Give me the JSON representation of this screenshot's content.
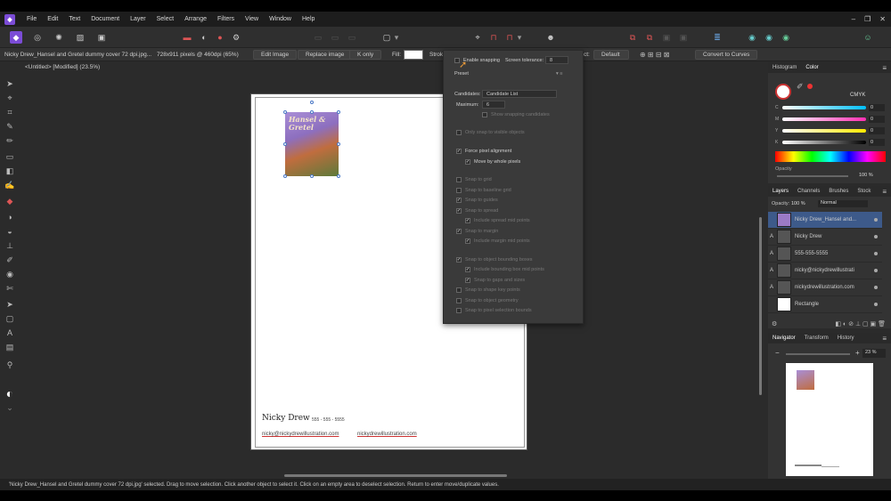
{
  "menu": {
    "items": [
      "File",
      "Edit",
      "Text",
      "Document",
      "Layer",
      "Select",
      "Arrange",
      "Filters",
      "View",
      "Window",
      "Help"
    ]
  },
  "window_controls": {
    "minimize": "–",
    "restore": "❐",
    "close": "✕"
  },
  "context_bar": {
    "file_label": "Nicky Drew_Hansel and Gretel dummy cover 72 dpi.jpg...",
    "dimensions": "728x911 pixels @ 460dpi (65%)",
    "edit_image": "Edit Image",
    "replace_image": "Replace image",
    "k_only": "K only",
    "fill_label": "Fill:",
    "stroke_label": "Strok",
    "select_label": "ct:",
    "select_value": "Default",
    "convert_curves": "Convert to Curves"
  },
  "doc_tab": "<Untitled> [Modified] (23.5%)",
  "document": {
    "art_title": "Hansel & Gretel",
    "sig_name": "Nicky Drew",
    "sig_phone": "555 - 555 - 5555",
    "sig_email": "nicky@nickydrewillustration.com",
    "sig_site": "nickydrewillustration.com"
  },
  "snapping": {
    "enable": "Enable snapping",
    "tolerance_label": "Screen tolerance:",
    "tolerance_value": "8",
    "preset": "Preset",
    "candidates_label": "Candidates:",
    "candidates_value": "Candidate List",
    "maximum_label": "Maximum:",
    "maximum_value": "6",
    "show_candidates": "Show snapping candidates",
    "only_visible": "Only snap to visible objects",
    "force_pixel": "Force pixel alignment",
    "move_whole": "Move by whole pixels",
    "snap_grid": "Snap to grid",
    "snap_baseline": "Snap to baseline grid",
    "snap_guides": "Snap to guides",
    "snap_spread": "Snap to spread",
    "spread_mid": "Include spread mid points",
    "snap_margin": "Snap to margin",
    "margin_mid": "Include margin mid points",
    "snap_bbox": "Snap to object bounding boxes",
    "bbox_mid": "Include bounding box mid points",
    "gaps_sizes": "Snap to gaps and sizes",
    "shape_key": "Snap to shape key points",
    "object_geometry": "Snap to object geometry",
    "pixel_bounds": "Snap to pixel selection bounds"
  },
  "color_panel": {
    "tabs": [
      "Histogram",
      "Color"
    ],
    "model": "CMYK",
    "channels": [
      {
        "label": "C",
        "value": "0"
      },
      {
        "label": "M",
        "value": "0"
      },
      {
        "label": "Y",
        "value": "0"
      },
      {
        "label": "K",
        "value": "0"
      }
    ],
    "opacity_label": "Opacity",
    "opacity_value": "100 %"
  },
  "layers_panel": {
    "tabs": [
      "Layers",
      "Channels",
      "Brushes",
      "Stock"
    ],
    "opacity_label": "Opacity:",
    "opacity_value": "100 %",
    "blend": "Normal",
    "layers": [
      {
        "type": "",
        "name": "Nicky Drew_Hansel and..."
      },
      {
        "type": "A",
        "name": "Nicky Drew"
      },
      {
        "type": "A",
        "name": "555-555-5555"
      },
      {
        "type": "A",
        "name": "nicky@nickydrewillustrati"
      },
      {
        "type": "A",
        "name": "nickydrewillustration.com"
      },
      {
        "type": "",
        "name": "Rectangle"
      }
    ]
  },
  "nav_panel": {
    "tabs": [
      "Navigator",
      "Transform",
      "History"
    ],
    "zoom": "23 %"
  },
  "status": {
    "text": "'Nicky Drew_Hansel and Gretel dummy cover 72 dpi.jpg' selected. Drag to move selection. Click another object to select it. Click on an empty area to deselect selection. Return to enter move/duplicate values."
  },
  "colors": {
    "accent": "#4a78c6",
    "brand": "#7b4cd6",
    "selected_layer": "#3d5a8a"
  }
}
